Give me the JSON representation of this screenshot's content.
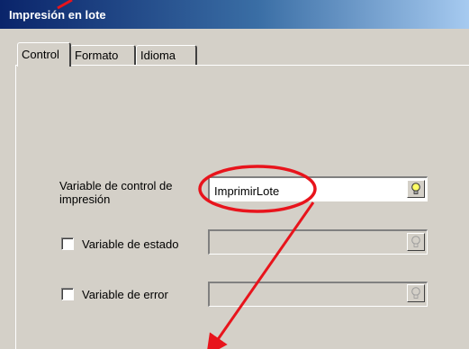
{
  "window": {
    "title": "Impresión en lote"
  },
  "tabs": [
    {
      "label": "Control",
      "active": true
    },
    {
      "label": "Formato",
      "active": false
    },
    {
      "label": "Idioma",
      "active": false
    }
  ],
  "form": {
    "print_control_label_line1": "Variable de control de",
    "print_control_label_line2": "impresión",
    "print_control_value": "ImprimirLote",
    "status_variable_label": "Variable de estado",
    "status_variable_value": "",
    "error_variable_label": "Variable de error",
    "error_variable_value": ""
  },
  "icons": {
    "browse": "lightbulb-icon"
  },
  "colors": {
    "titlebar_start": "#0a246a",
    "titlebar_end": "#a6caf0",
    "dialog_face": "#d4d0c8",
    "annotation": "#e8141c",
    "lightbulb_active": "#ffff66"
  }
}
